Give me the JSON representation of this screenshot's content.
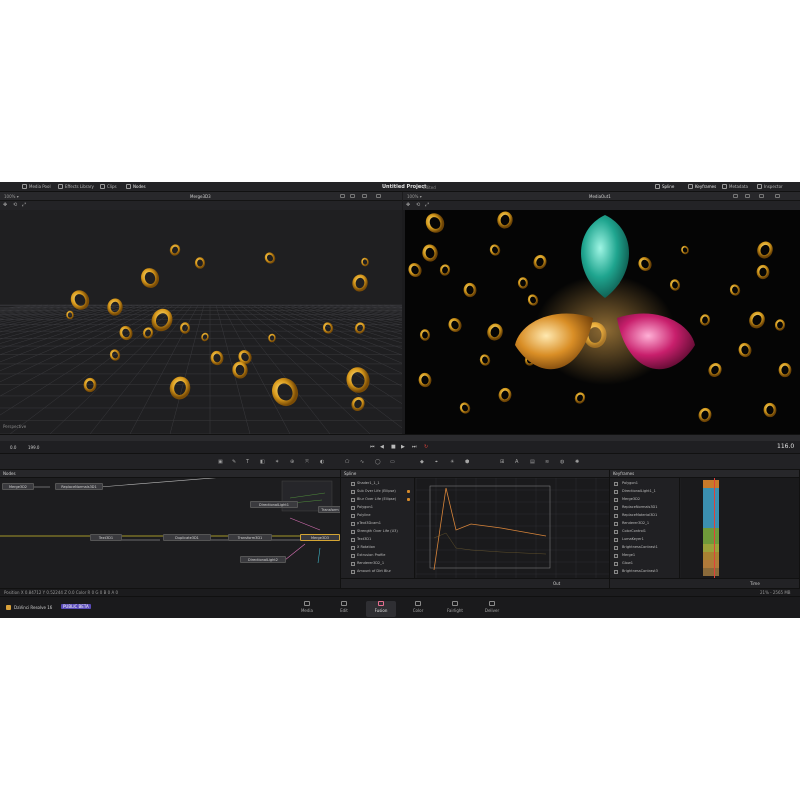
{
  "topbar": {
    "left_tabs": [
      "Media Pool",
      "Effects Library",
      "Clips",
      "Nodes"
    ],
    "project_title": "Untitled Project",
    "project_status": "Edited",
    "right_tabs": [
      "Spline",
      "Keyframes",
      "Metadata",
      "Inspector"
    ]
  },
  "viewer_left": {
    "title": "Merge3D3",
    "zoom": "100% ▾",
    "overlay_label": "Perspective"
  },
  "viewer_right": {
    "title": "MediaOut1",
    "zoom": "100% ▾"
  },
  "transport": {
    "start_frame": "0.0",
    "end_frame": "199.0",
    "current_frame": "116.0"
  },
  "nodes_panel": {
    "title": "Nodes",
    "nodes": [
      {
        "label": "Merge3D2"
      },
      {
        "label": "ReplaceNormals3D1"
      },
      {
        "label": "DirectionalLight1"
      },
      {
        "label": "Transform"
      },
      {
        "label": "Text3D1"
      },
      {
        "label": "Duplicate3D1"
      },
      {
        "label": "Transform3D1"
      },
      {
        "label": "Merge3D3"
      },
      {
        "label": "DirectionalLight2"
      }
    ]
  },
  "spline_panel": {
    "title": "Spline",
    "tree": [
      "Shader1_1_1",
      "Sub Over Life (Ellipse)",
      "Blur Over Life (Ellipse)",
      "Polygon1",
      "Polyline",
      "pText3Dcam1",
      "Strength Over Life (U3)",
      "Text3D1",
      "X Rotation",
      "Extrusion Profile",
      "Renderer3D2_1",
      "Amount of Dirt Blur"
    ],
    "footer_value": "Out"
  },
  "keyframes_panel": {
    "title": "Keyframes",
    "rows": [
      "Polygon1",
      "DirectionalLight1_1",
      "Merge3D2",
      "ReplaceNormals3D1",
      "ReplaceMaterial3D1",
      "Renderer3D2_1",
      "ColorControl1",
      "LumaKeyer1",
      "BrightnessContrast1",
      "Merge1",
      "Glow1",
      "BrightnessContrast3"
    ],
    "footer_value": "Time"
  },
  "statusbar": {
    "left": "Position   X 0.84712   Y 0.52244   Z 0.0   Color   R 0   G 0   B 0   A 0",
    "right": "21% - 2565 MB"
  },
  "app": {
    "name": "DaVinci Resolve 16",
    "badge": "PUBLIC BETA"
  },
  "pages": [
    "Media",
    "Edit",
    "Fusion",
    "Color",
    "Fairlight",
    "Deliver"
  ],
  "active_page": "Fusion",
  "colors": {
    "accent": "#d4a534",
    "playhead": "#e0413a",
    "background": "#1c1c1e"
  }
}
